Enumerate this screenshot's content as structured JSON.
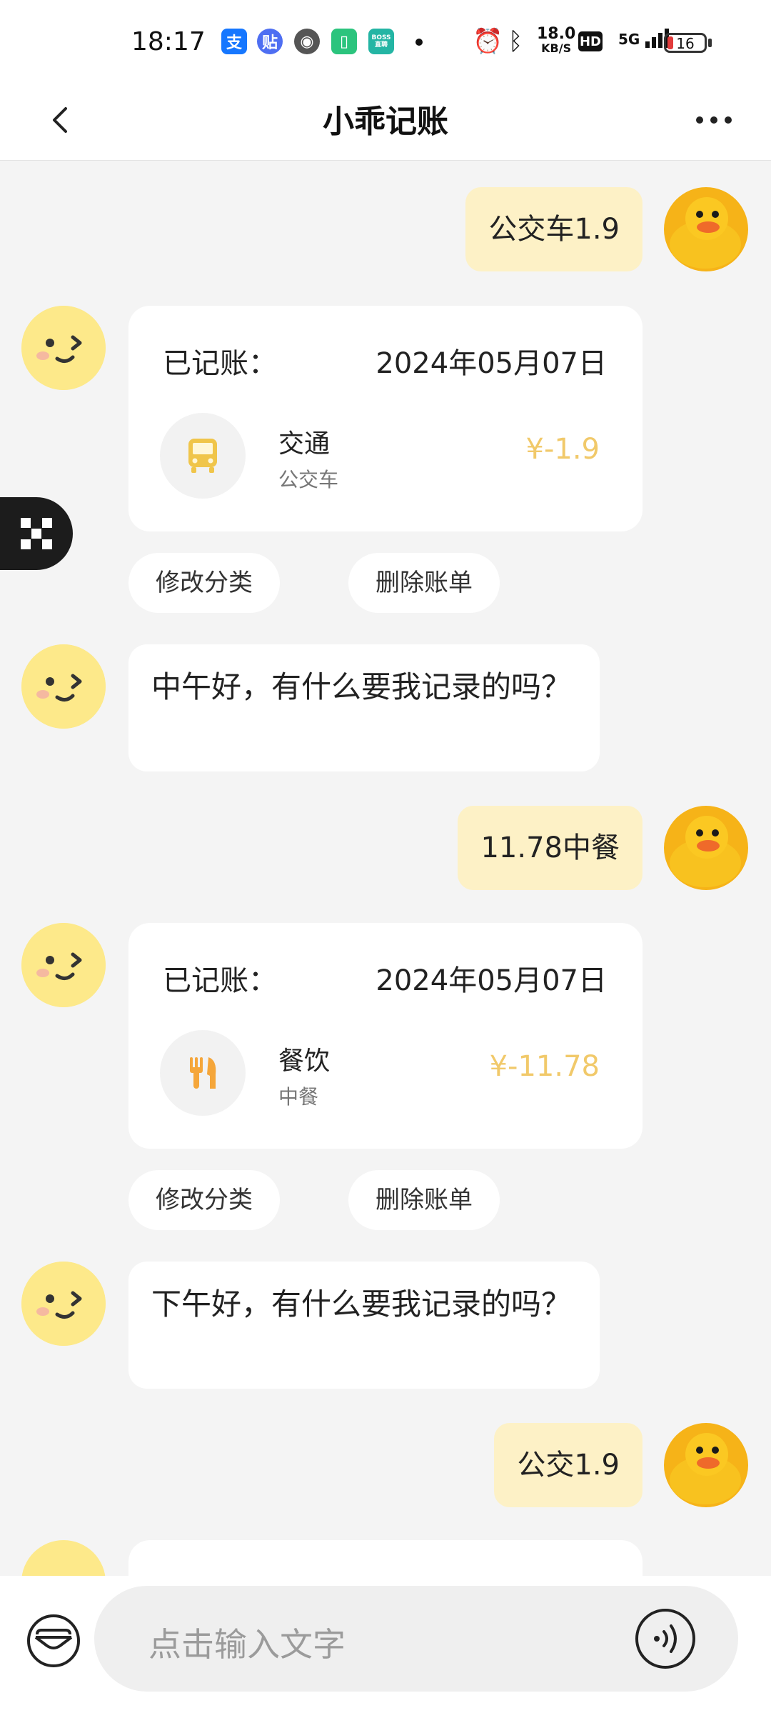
{
  "status_bar": {
    "time": "18:17",
    "apps": [
      {
        "icon": "alipay-icon",
        "glyph": "支",
        "color": "#1677ff"
      },
      {
        "icon": "tieba-icon",
        "glyph": "贴",
        "color": "#4e6ef2"
      },
      {
        "icon": "browser-icon",
        "glyph": "◉",
        "color": "#555555"
      },
      {
        "icon": "battery-app-icon",
        "glyph": "▯",
        "color": "#2bc47d"
      },
      {
        "icon": "boss-zhipin-icon",
        "glyph": "BOSS直聘",
        "color": "#24b5a4"
      }
    ],
    "speed_value": "18.0",
    "speed_unit": "KB/S",
    "hd": "HD",
    "network": "5G",
    "battery": "16"
  },
  "nav": {
    "title": "小乖记账"
  },
  "messages": {
    "user1": "公交车1.9",
    "card1": {
      "label": "已记账：",
      "date": "2024年05月07日",
      "category": "交通",
      "note": "公交车",
      "amount": "¥-1.9"
    },
    "edit_category": "修改分类",
    "delete_bill": "删除账单",
    "bot_noon": "中午好，有什么要我记录的吗？",
    "user2": "11.78中餐",
    "card2": {
      "label": "已记账：",
      "date": "2024年05月07日",
      "category": "餐饮",
      "note": "中餐",
      "amount": "¥-11.78"
    },
    "bot_afternoon": "下午好，有什么要我记录的吗？",
    "user3": "公交1.9"
  },
  "input": {
    "placeholder": "点击输入文字"
  },
  "colors": {
    "accent_amount": "#f1c96a",
    "user_bubble": "#fdf1c6",
    "category_icon": "#f0c54a",
    "food_icon": "#f5a63a"
  }
}
